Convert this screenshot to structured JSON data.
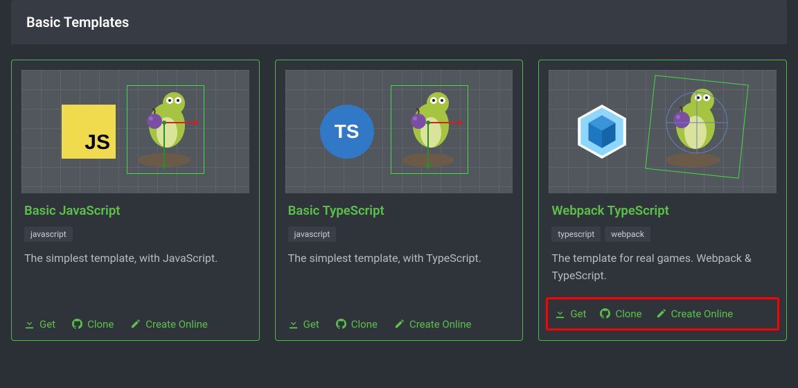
{
  "section_title": "Basic Templates",
  "cards": [
    {
      "title": "Basic JavaScript",
      "tags": [
        "javascript"
      ],
      "desc": "The simplest template, with JavaScript.",
      "get": "Get",
      "clone": "Clone",
      "create": "Create Online",
      "logo": {
        "kind": "js",
        "text": "JS"
      }
    },
    {
      "title": "Basic TypeScript",
      "tags": [
        "javascript"
      ],
      "desc": "The simplest template, with TypeScript.",
      "get": "Get",
      "clone": "Clone",
      "create": "Create Online",
      "logo": {
        "kind": "ts",
        "text": "TS"
      }
    },
    {
      "title": "Webpack TypeScript",
      "tags": [
        "typescript",
        "webpack"
      ],
      "desc": "The template for real games. Webpack & TypeScript.",
      "get": "Get",
      "clone": "Clone",
      "create": "Create Online",
      "logo": {
        "kind": "webpack"
      },
      "highlighted_actions": true
    }
  ]
}
